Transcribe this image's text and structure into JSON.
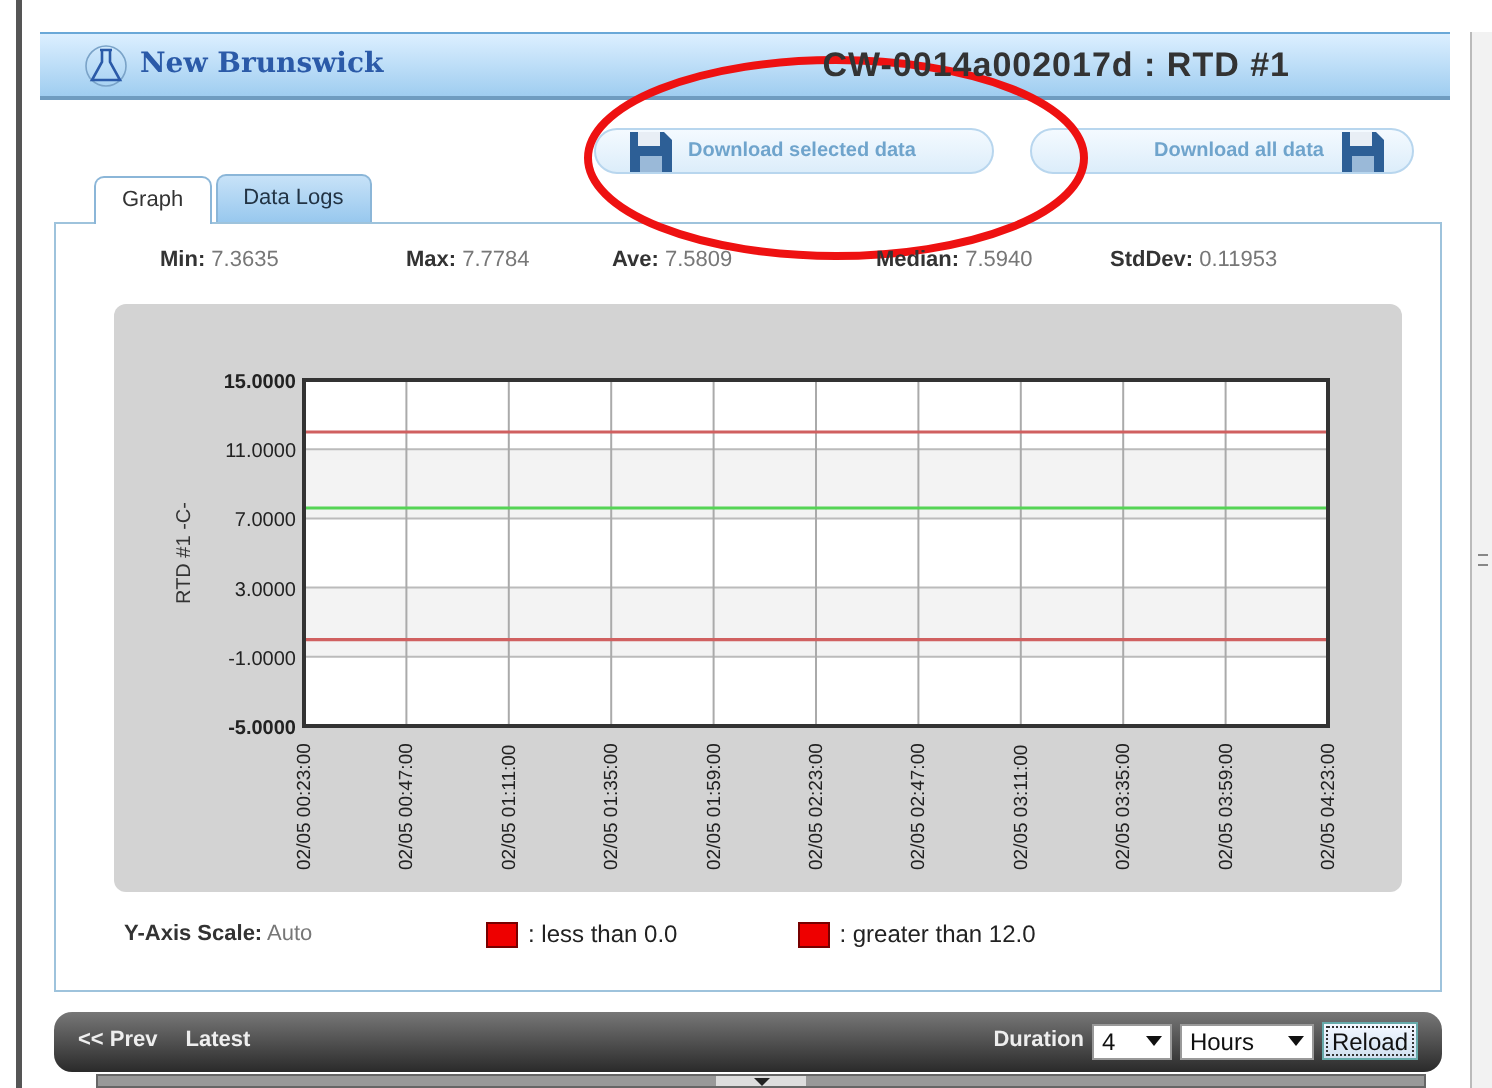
{
  "header": {
    "logo": "New Brunswick",
    "title": "CW-0014a002017d : RTD #1"
  },
  "downloads": [
    {
      "label": "Download selected data",
      "kind": "icon-left"
    },
    {
      "label": "Download all data",
      "kind": "icon-right"
    }
  ],
  "tabs": [
    {
      "label": "Graph",
      "selected": true
    },
    {
      "label": "Data Logs",
      "selected": false
    }
  ],
  "stats": [
    {
      "label": "Min:",
      "value": "7.3635"
    },
    {
      "label": "Max:",
      "value": "7.7784"
    },
    {
      "label": "Ave:",
      "value": "7.5809"
    },
    {
      "label": "Median:",
      "value": "7.5940"
    },
    {
      "label": "StdDev:",
      "value": "0.11953"
    }
  ],
  "chart_data": {
    "type": "line",
    "ylabel": "RTD #1 -C-",
    "categories": [
      "02/05 00:23:00",
      "02/05 00:47:00",
      "02/05 01:11:00",
      "02/05 01:35:00",
      "02/05 01:59:00",
      "02/05 02:23:00",
      "02/05 02:47:00",
      "02/05 03:11:00",
      "02/05 03:35:00",
      "02/05 03:59:00",
      "02/05 04:23:00"
    ],
    "series": [
      {
        "color": "#55d455",
        "values": [
          7.6,
          7.6,
          7.6,
          7.6,
          7.6,
          7.6,
          7.6,
          7.6,
          7.6,
          7.6,
          7.6
        ]
      },
      {
        "color": "#d06060",
        "values": [
          0,
          0,
          0,
          0,
          0,
          0,
          0,
          0,
          0,
          0,
          0
        ]
      },
      {
        "color": "#d06060",
        "values": [
          12,
          12,
          12,
          12,
          12,
          12,
          12,
          12,
          12,
          12,
          12
        ]
      }
    ],
    "grid": true,
    "ylim": [
      -5,
      15
    ],
    "yticks": [
      {
        "value": -5,
        "label": "-5.0000"
      },
      {
        "value": -1,
        "label": "-1.0000"
      },
      {
        "value": 3,
        "label": "3.0000"
      },
      {
        "value": 7,
        "label": "7.0000"
      },
      {
        "value": 11,
        "label": "11.0000"
      },
      {
        "value": 15,
        "label": "15.0000"
      }
    ]
  },
  "y_axis_scale": {
    "label": "Y-Axis Scale:",
    "value": "Auto"
  },
  "legend": [
    {
      "color": "#ee0000",
      "label": ": less than 0.0"
    },
    {
      "color": "#ee0000",
      "label": ": greater than 12.0"
    }
  ],
  "toolbar": {
    "prev": "<< Prev",
    "latest": "Latest",
    "duration_label": "Duration",
    "duration_value": "4",
    "unit": "Hours",
    "reload": "Reload"
  },
  "annotation": {
    "kind": "ellipse",
    "color": "#ee1111"
  }
}
